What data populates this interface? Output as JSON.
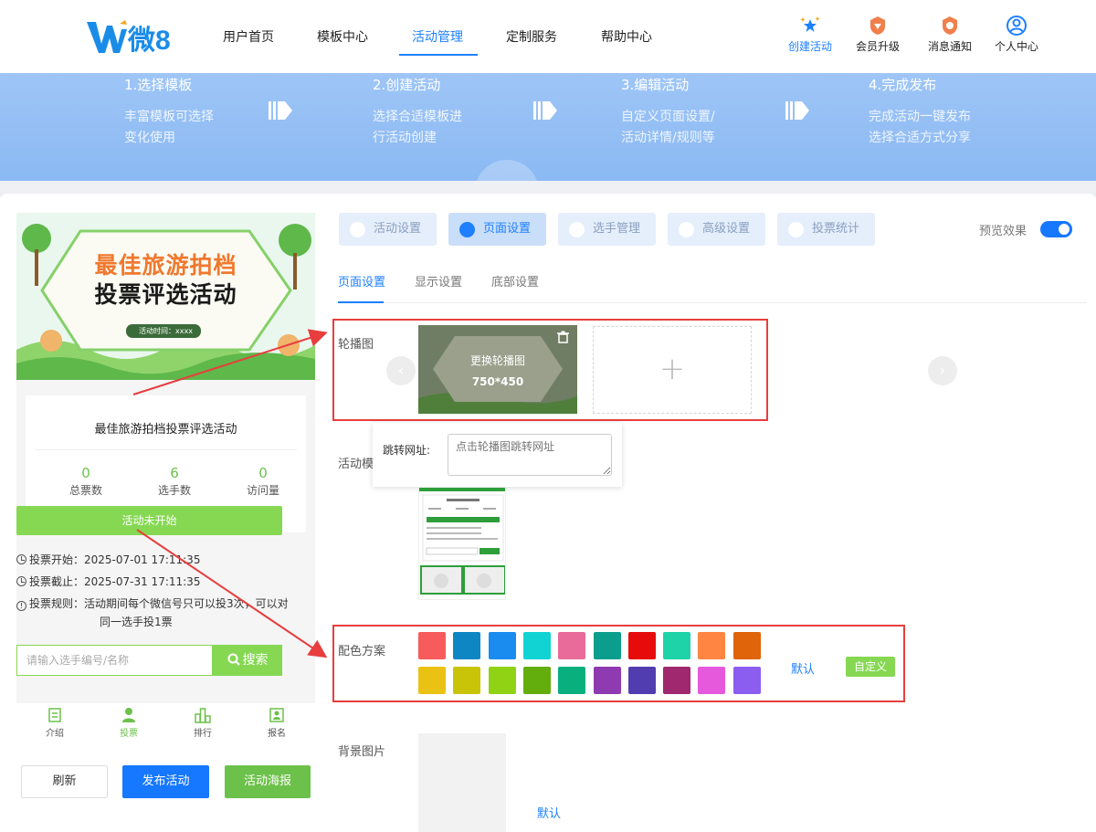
{
  "header": {
    "logo_text": "微8",
    "nav": [
      "用户首页",
      "模板中心",
      "活动管理",
      "定制服务",
      "帮助中心"
    ],
    "nav_active": "活动管理",
    "icons": [
      {
        "label": "创建活动",
        "icon": "star-sparkle-icon",
        "color": "#1e80ff"
      },
      {
        "label": "会员升级",
        "icon": "vip-badge-icon"
      },
      {
        "label": "消息通知",
        "icon": "notice-badge-icon"
      },
      {
        "label": "个人中心",
        "icon": "user-circle-icon"
      }
    ]
  },
  "steps": [
    {
      "title": "1.选择模板",
      "line1": "丰富模板可选择",
      "line2": "变化使用"
    },
    {
      "title": "2.创建活动",
      "line1": "选择合适模板进",
      "line2": "行活动创建"
    },
    {
      "title": "3.编辑活动",
      "line1": "自定义页面设置/",
      "line2": "活动详情/规则等"
    },
    {
      "title": "4.完成发布",
      "line1": "完成活动一键发布",
      "line2": "选择合适方式分享"
    }
  ],
  "preview": {
    "hero_title1": "最佳旅游拍档",
    "hero_title2": "投票评选活动",
    "hero_time": "活动时间：xxxx",
    "card_title": "最佳旅游拍档投票评选活动",
    "stats": [
      {
        "value": "0",
        "label": "总票数"
      },
      {
        "value": "6",
        "label": "选手数"
      },
      {
        "value": "0",
        "label": "访问量"
      }
    ],
    "status": "活动未开始",
    "vote_start": "投票开始：2025-07-01 17:11:35",
    "vote_end": "投票截止：2025-07-31 17:11:35",
    "rule1": "投票规则：活动期间每个微信号只可以投3次，可以对",
    "rule2": "同一选手投1票",
    "search_placeholder": "请输入选手编号/名称",
    "search_btn": "搜索",
    "tabbar": [
      "介绍",
      "投票",
      "排行",
      "报名"
    ],
    "tabbar_active": "投票"
  },
  "actions": {
    "refresh": "刷新",
    "publish": "发布活动",
    "poster": "活动海报"
  },
  "panel": {
    "tabs": [
      "活动设置",
      "页面设置",
      "选手管理",
      "高级设置",
      "投票统计"
    ],
    "tab_active": "页面设置",
    "preview_label": "预览效果",
    "preview_on": true,
    "subtabs": [
      "页面设置",
      "显示设置",
      "底部设置"
    ],
    "subtab_active": "页面设置",
    "carousel_label": "轮播图",
    "carousel_overlay": "更换轮播图",
    "carousel_size": "750*450",
    "link_label": "跳转网址:",
    "link_placeholder": "点击轮播图跳转网址",
    "template_label": "活动模",
    "color_label": "配色方案",
    "colors": [
      "#f75b5b",
      "#0e86c4",
      "#1a8cf0",
      "#12d3d3",
      "#e96b9a",
      "#0b9e8c",
      "#e60c0c",
      "#1ed3a7",
      "#ff8642",
      "#e0640a",
      "#eac214",
      "#c9c408",
      "#8fd314",
      "#63ae0c",
      "#09af7d",
      "#8e3ab0",
      "#523db0",
      "#a0286e",
      "#e659dd",
      "#8b5ef0"
    ],
    "color_default": "默认",
    "color_custom": "自定义",
    "bg_label": "背景图片",
    "bg_default": "默认"
  }
}
